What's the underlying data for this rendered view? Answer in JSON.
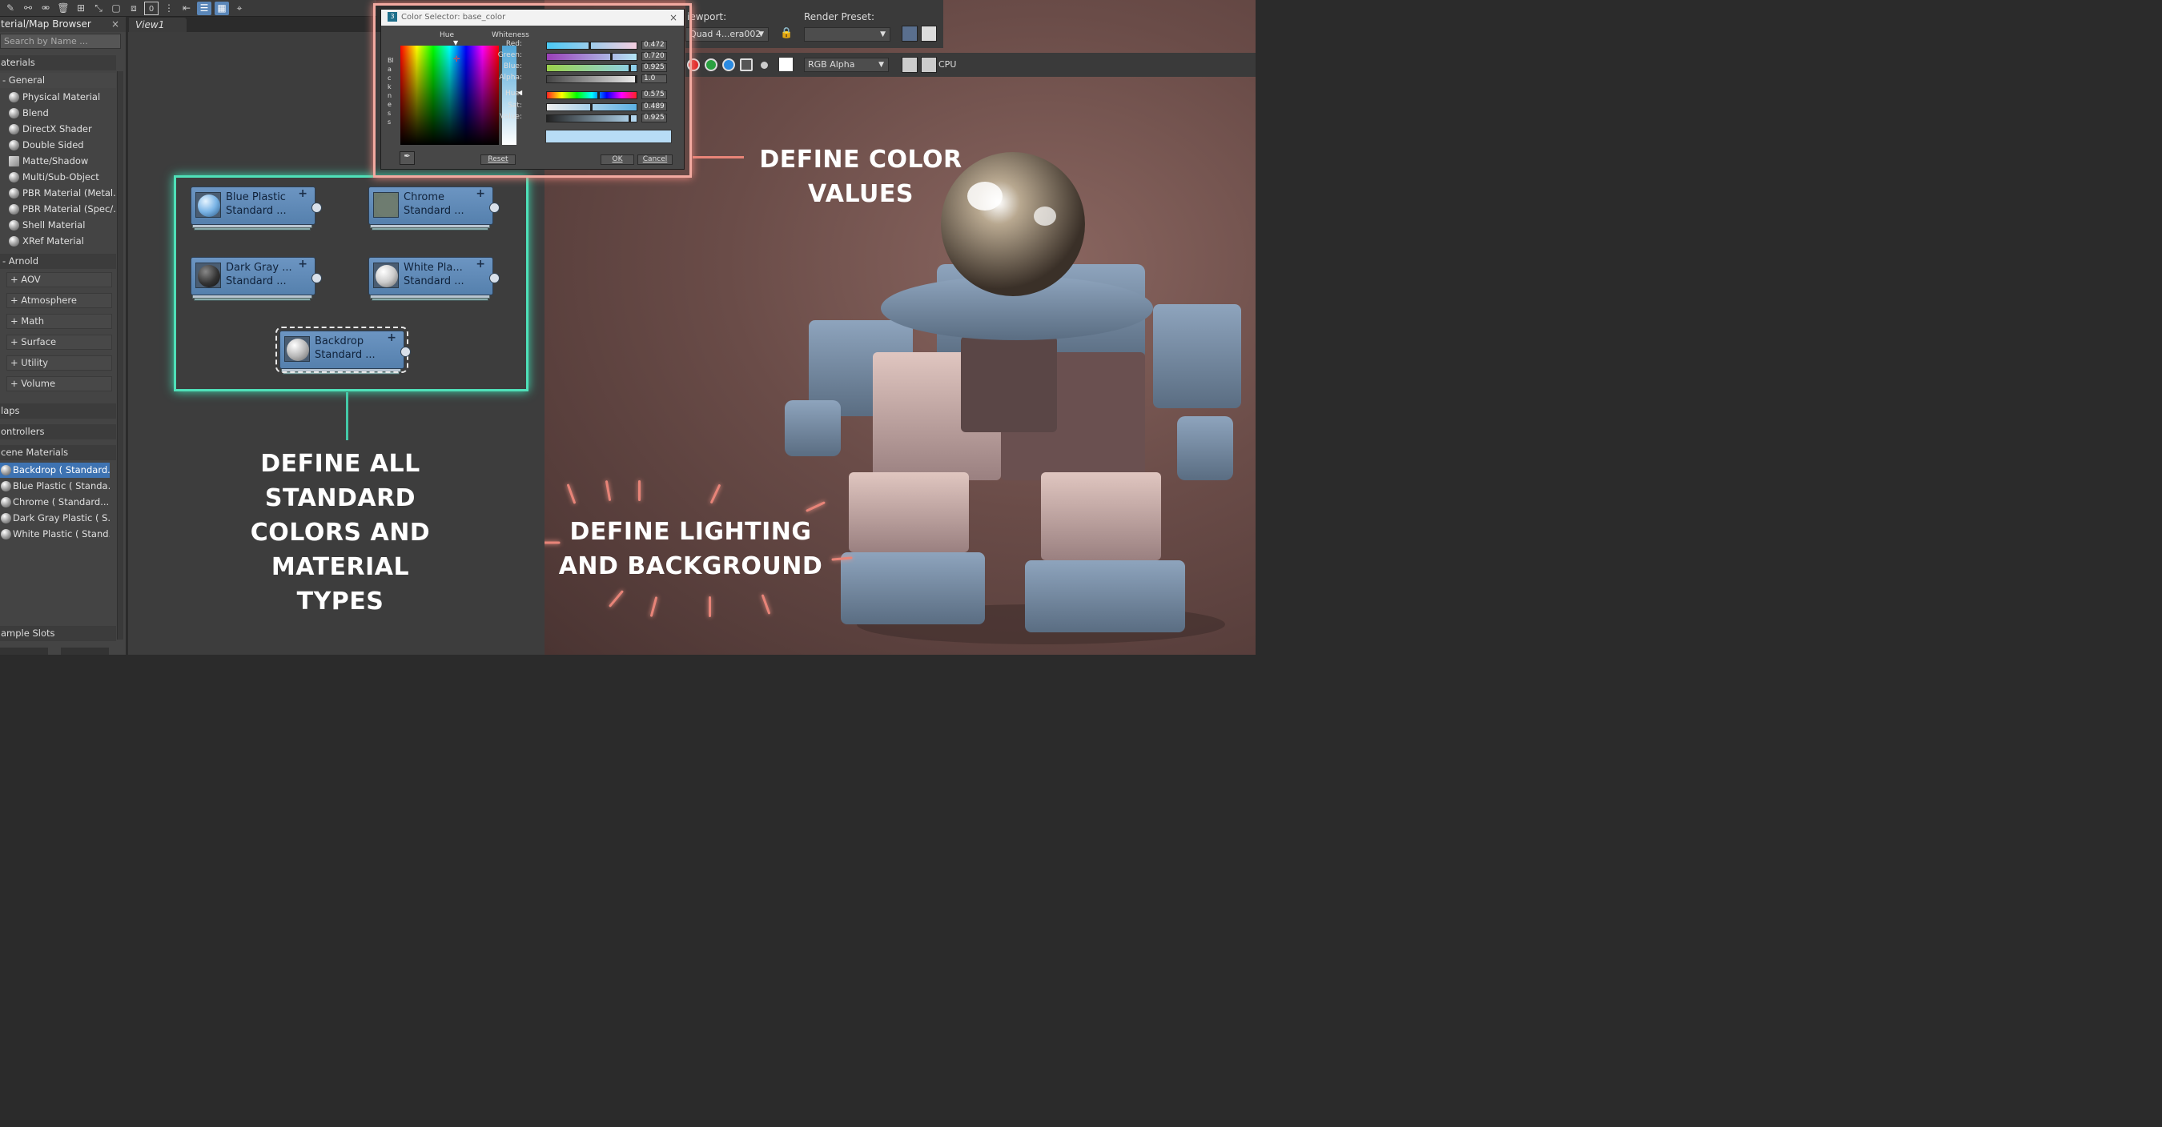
{
  "toolbar": {
    "icons": [
      "pencil-icon",
      "link-icon",
      "unlink-icon",
      "trash-icon",
      "layout-icon",
      "move-icon",
      "select-icon",
      "frame-icon",
      "frame-all-icon",
      "number-icon",
      "split-icon",
      "arrange-icon",
      "list-view-icon",
      "grid-view-icon",
      "pick-icon"
    ],
    "box_label": "0"
  },
  "browser": {
    "title": "terial/Map Browser",
    "close": "×",
    "search_placeholder": "Search by Name ...",
    "materials_header": "aterials",
    "general_header": "- General",
    "general_items": [
      "Physical Material",
      "Blend",
      "DirectX Shader",
      "Double Sided",
      "Matte/Shadow",
      "Multi/Sub-Object",
      "PBR Material (Metal...",
      "PBR Material (Spec/...",
      "Shell Material",
      "XRef Material"
    ],
    "arnold_header": "- Arnold",
    "arnold_items": [
      "+ AOV",
      "+ Atmosphere",
      "+ Math",
      "+ Surface",
      "+ Utility",
      "+ Volume"
    ],
    "maps_header": "laps",
    "controllers_header": "ontrollers",
    "scene_header": "cene Materials",
    "scene_items": [
      "Backdrop  ( Standard...",
      "Blue Plastic  ( Standa...",
      "Chrome  ( Standard...",
      "Dark Gray Plastic  ( S...",
      "White Plastic  ( Stand..."
    ],
    "sample_header": "ample Slots"
  },
  "view": {
    "tab": "View1"
  },
  "nodes": [
    {
      "title": "Blue Plastic",
      "type": "Standard ...",
      "plus": "+"
    },
    {
      "title": "Chrome",
      "type": "Standard ...",
      "plus": "+"
    },
    {
      "title": "Dark  Gray ...",
      "type": "Standard ...",
      "plus": "+"
    },
    {
      "title": "White  Pla...",
      "type": "Standard ...",
      "plus": "+"
    },
    {
      "title": "Backdrop",
      "type": "Standard ...",
      "plus": "+"
    }
  ],
  "callouts": {
    "materials": [
      "DEFINE ALL",
      "STANDARD",
      "COLORS AND",
      "MATERIAL",
      "TYPES"
    ],
    "color": [
      "DEFINE COLOR",
      "VALUES"
    ],
    "lighting": [
      "DEFINE LIGHTING",
      "AND BACKGROUND"
    ]
  },
  "render": {
    "viewport_label": "iewport:",
    "viewport_value": "Quad 4...era002",
    "preset_label": "Render Preset:",
    "preset_value": "",
    "channel_value": "RGB Alpha",
    "cpu_label": "CPU"
  },
  "dialog": {
    "title": "Color Selector: base_color",
    "close": "×",
    "hue_label": "Hue",
    "whiteness_label": "Whiteness",
    "blackness_label": "Blackness",
    "sliders": [
      {
        "label": "Red:",
        "value": "0.472"
      },
      {
        "label": "Green:",
        "value": "0.720"
      },
      {
        "label": "Blue:",
        "value": "0.925"
      },
      {
        "label": "Alpha:",
        "value": "1.0"
      },
      {
        "label": "Hue:",
        "value": "0.575"
      },
      {
        "label": "Sat:",
        "value": "0.489"
      },
      {
        "label": "Value:",
        "value": "0.925"
      }
    ],
    "reset": "Reset",
    "ok": "OK",
    "cancel": "Cancel",
    "swatch_color": "#b7dcf5"
  }
}
